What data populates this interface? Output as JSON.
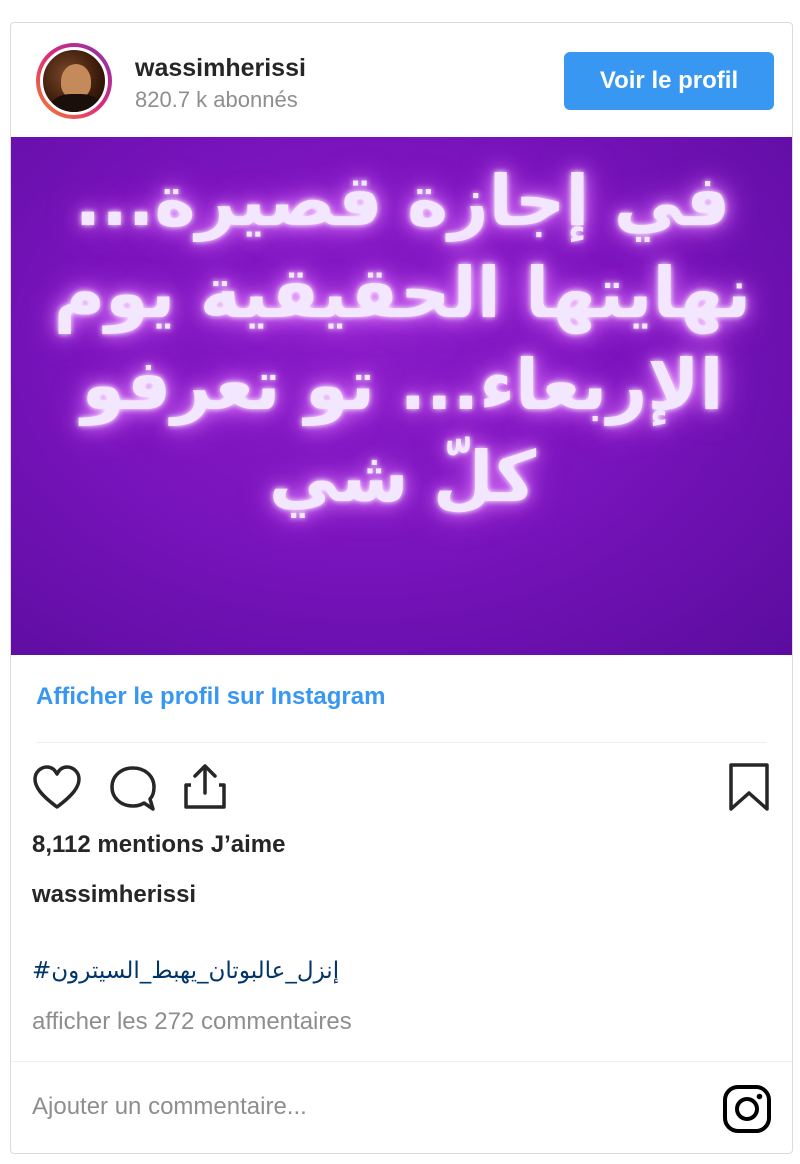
{
  "header": {
    "username": "wassimherissi",
    "followers": "820.7 k abonnés",
    "follow_button": "Voir le profil"
  },
  "post": {
    "image_text_lines": [
      "في إجازة قصيرة...",
      "نهايتها الحقيقية يوم",
      "الإربعاء... تو تعرفو",
      "كلّ شي"
    ]
  },
  "view_profile_link": "Afficher le profil sur Instagram",
  "actions": {
    "icons": [
      "heart-icon",
      "comment-icon",
      "share-icon",
      "bookmark-icon"
    ]
  },
  "likes": "8,112 mentions J’aime",
  "caption": {
    "username": "wassimherissi",
    "hashtag": "إنزل_عالبوتان_يهبط_السيترون#"
  },
  "comments_link": "afficher les 272 commentaires",
  "comment_box": {
    "placeholder": "Ajouter un commentaire..."
  },
  "colors": {
    "accent": "#3897f0",
    "post_background": "#7a14bd",
    "hashtag": "#003569",
    "muted_text": "#8e8e8e"
  }
}
